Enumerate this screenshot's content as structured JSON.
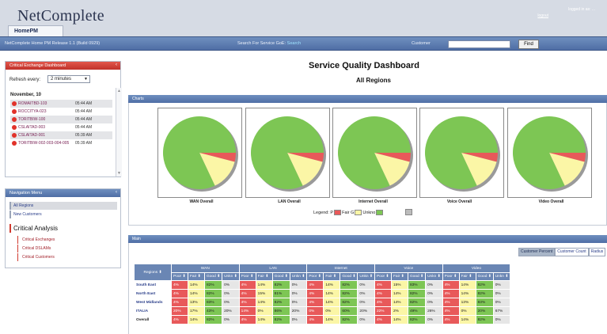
{
  "app": {
    "logo": "NetComplete",
    "top_tab": "HomePM",
    "logged_in": "logged in as: ...",
    "logout": "logout"
  },
  "navbar": {
    "release": "NetComplete Home PM Release 1.1 (Build 0929)",
    "search_label": "Search For Service GoE:",
    "search_link": "Search",
    "customer_label": "Customer",
    "customer_value": "",
    "find_label": "Find"
  },
  "critical_panel": {
    "title": "Critical Exchange Dashboard",
    "refresh_label": "Refresh every:",
    "refresh_value": "2 minutes",
    "date": "November, 10",
    "alarms": [
      {
        "name": "ROMAITBD-103",
        "time": "05:44 AM"
      },
      {
        "name": "ROCCITYA-023",
        "time": "05:44 AM"
      },
      {
        "name": "TORITBIW-100",
        "time": "05:44 AM"
      },
      {
        "name": "CSLAITAD-003",
        "time": "05:44 AM"
      },
      {
        "name": "CSLAITAD-001",
        "time": "05:39 AM"
      },
      {
        "name": "TORITBIW-002-003-004-005",
        "time": "05:39 AM"
      }
    ]
  },
  "nav_menu": {
    "title": "Navigation Menu",
    "items": [
      "All Regions",
      "New Customers"
    ],
    "critical_heading": "Critical Analysis",
    "critical_items": [
      "Critical Exchanges",
      "Critical DSLAMs",
      "Critical Customers"
    ]
  },
  "main": {
    "title": "Service Quality Dashboard",
    "subtitle": "All Regions",
    "charts_bar": "Charts",
    "main_bar": "Main",
    "legend_label": "Legend:",
    "legend_items": [
      "P",
      "Fair G",
      "Unkno"
    ],
    "view_buttons": [
      "Customer Percent",
      "Customer Count",
      "Radius"
    ]
  },
  "chart_data": [
    {
      "type": "pie",
      "title": "WAN Overall",
      "labels": [
        "Poor",
        "Fair",
        "Good"
      ],
      "values": [
        4,
        14,
        82
      ]
    },
    {
      "type": "pie",
      "title": "LAN Overall",
      "labels": [
        "Poor",
        "Fair",
        "Good"
      ],
      "values": [
        4,
        14,
        82
      ]
    },
    {
      "type": "pie",
      "title": "Internet Overall",
      "labels": [
        "Poor",
        "Fair",
        "Good"
      ],
      "values": [
        4,
        14,
        82
      ]
    },
    {
      "type": "pie",
      "title": "Voice Overall",
      "labels": [
        "Poor",
        "Fair",
        "Good"
      ],
      "values": [
        4,
        14,
        82
      ]
    },
    {
      "type": "pie",
      "title": "Video Overall",
      "labels": [
        "Poor",
        "Fair",
        "Good"
      ],
      "values": [
        4,
        14,
        82
      ]
    }
  ],
  "colors": {
    "poor": "#e8595a",
    "fair": "#fbf6a6",
    "good": "#7dc654",
    "unknown": "#bcbcbc"
  },
  "table": {
    "region_header": "Regions",
    "groups": [
      "WAN",
      "LAN",
      "Internet",
      "Voice",
      "Video"
    ],
    "sub_headers": [
      "Poor",
      "Fair",
      "Good",
      "Unkn"
    ],
    "rows": [
      {
        "region": "South East",
        "cells": [
          "4%",
          "14%",
          "82%",
          "0%",
          "4%",
          "14%",
          "82%",
          "0%",
          "4%",
          "14%",
          "82%",
          "0%",
          "4%",
          "15%",
          "83%",
          "0%",
          "4%",
          "14%",
          "82%",
          "0%"
        ]
      },
      {
        "region": "North East",
        "cells": [
          "4%",
          "14%",
          "82%",
          "0%",
          "4%",
          "15%",
          "81%",
          "0%",
          "4%",
          "14%",
          "82%",
          "0%",
          "4%",
          "14%",
          "82%",
          "0%",
          "4%",
          "14%",
          "82%",
          "0%"
        ]
      },
      {
        "region": "West Midlands",
        "cells": [
          "4%",
          "13%",
          "83%",
          "0%",
          "4%",
          "14%",
          "82%",
          "0%",
          "4%",
          "14%",
          "82%",
          "0%",
          "4%",
          "14%",
          "82%",
          "0%",
          "4%",
          "13%",
          "83%",
          "0%"
        ]
      },
      {
        "region": "ITALIA",
        "cells": [
          "20%",
          "17%",
          "43%",
          "20%",
          "14%",
          "0%",
          "86%",
          "20%",
          "0%",
          "0%",
          "60%",
          "20%",
          "22%",
          "2%",
          "49%",
          "26%",
          "4%",
          "0%",
          "20%",
          "67%"
        ]
      },
      {
        "region": "Overall",
        "cells": [
          "4%",
          "14%",
          "82%",
          "0%",
          "4%",
          "14%",
          "82%",
          "0%",
          "4%",
          "14%",
          "82%",
          "0%",
          "4%",
          "14%",
          "82%",
          "0%",
          "4%",
          "14%",
          "82%",
          "0%"
        ]
      }
    ]
  }
}
